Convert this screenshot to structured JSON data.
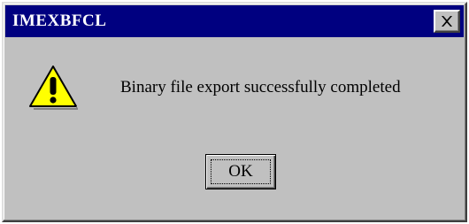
{
  "window": {
    "title": "IMEXBFCL",
    "close_icon": "close-icon"
  },
  "dialog": {
    "icon": "warning-icon",
    "message": "Binary file export successfully completed",
    "ok_label": "OK"
  },
  "colors": {
    "titlebar": "#000080",
    "face": "#c0c0c0",
    "warning_fill": "#ffff00"
  }
}
